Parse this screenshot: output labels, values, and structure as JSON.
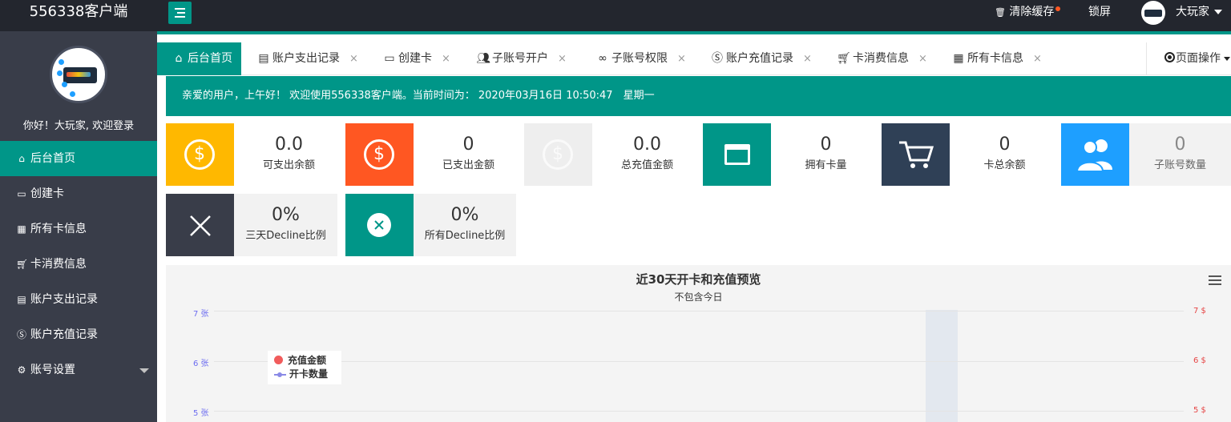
{
  "app": {
    "brand": "556338客户端"
  },
  "topbar": {
    "clear_cache": "清除缓存",
    "lock_screen": "锁屏",
    "username": "大玩家"
  },
  "sidebar": {
    "welcome": "你好！大玩家, 欢迎登录",
    "items": [
      {
        "label": "后台首页",
        "icon": "home-icon"
      },
      {
        "label": "创建卡",
        "icon": "card-icon"
      },
      {
        "label": "所有卡信息",
        "icon": "table-icon"
      },
      {
        "label": "卡消费信息",
        "icon": "cart-icon"
      },
      {
        "label": "账户支出记录",
        "icon": "clipboard-icon"
      },
      {
        "label": "账户充值记录",
        "icon": "dollar-icon"
      },
      {
        "label": "账号设置",
        "icon": "gear-icon"
      }
    ]
  },
  "tabs": [
    {
      "label": "后台首页",
      "icon": "home-icon"
    },
    {
      "label": "账户支出记录",
      "icon": "clipboard-icon"
    },
    {
      "label": "创建卡",
      "icon": "card-icon"
    },
    {
      "label": "子账号开户",
      "icon": "users-icon"
    },
    {
      "label": "子账号权限",
      "icon": "link-icon"
    },
    {
      "label": "账户充值记录",
      "icon": "dollar-icon"
    },
    {
      "label": "卡消费信息",
      "icon": "cart-icon"
    },
    {
      "label": "所有卡信息",
      "icon": "table-icon"
    }
  ],
  "tab_close": "×",
  "page_ops": "页面操作",
  "notice": "亲爱的用户，上午好！ 欢迎使用556338客户端。当前时间为： 2020年03月16日 10:50:47　星期一",
  "stats": [
    {
      "value": "0.0",
      "label": "可支出余额",
      "color": "#ffb800",
      "icon": "dollar-circle-icon"
    },
    {
      "value": "0",
      "label": "已支出金额",
      "color": "#ff5722",
      "icon": "dollar-circle-icon"
    },
    {
      "value": "0.0",
      "label": "总充值金额",
      "color": "#eeeeee",
      "icon": "dollar-circle-icon"
    },
    {
      "value": "0",
      "label": "拥有卡量",
      "color": "#009688",
      "icon": "card-icon"
    },
    {
      "value": "0",
      "label": "卡总余额",
      "color": "#2f4056",
      "icon": "cart-icon"
    },
    {
      "value": "0",
      "label": "子账号数量",
      "color": "#1e9fff",
      "icon": "users-icon"
    },
    {
      "value": "0%",
      "label": "三天Decline比例",
      "color": "#393d49",
      "icon": "close-icon"
    },
    {
      "value": "0%",
      "label": "所有Decline比例",
      "color": "#009688",
      "icon": "close-circle-icon"
    }
  ],
  "chart_data": {
    "type": "line",
    "title": "近30天开卡和充值预览",
    "subtitle": "不包含今日",
    "y_left_ticks": [
      "7 张",
      "6 张",
      "5 张"
    ],
    "y_right_ticks": [
      "7 $",
      "6 $",
      "5 $"
    ],
    "series": [
      {
        "name": "充值金额",
        "color": "#f15c5c",
        "values": []
      },
      {
        "name": "开卡数量",
        "color": "#8a8ae6",
        "values": []
      }
    ],
    "grid": true,
    "legend": "top-left"
  }
}
